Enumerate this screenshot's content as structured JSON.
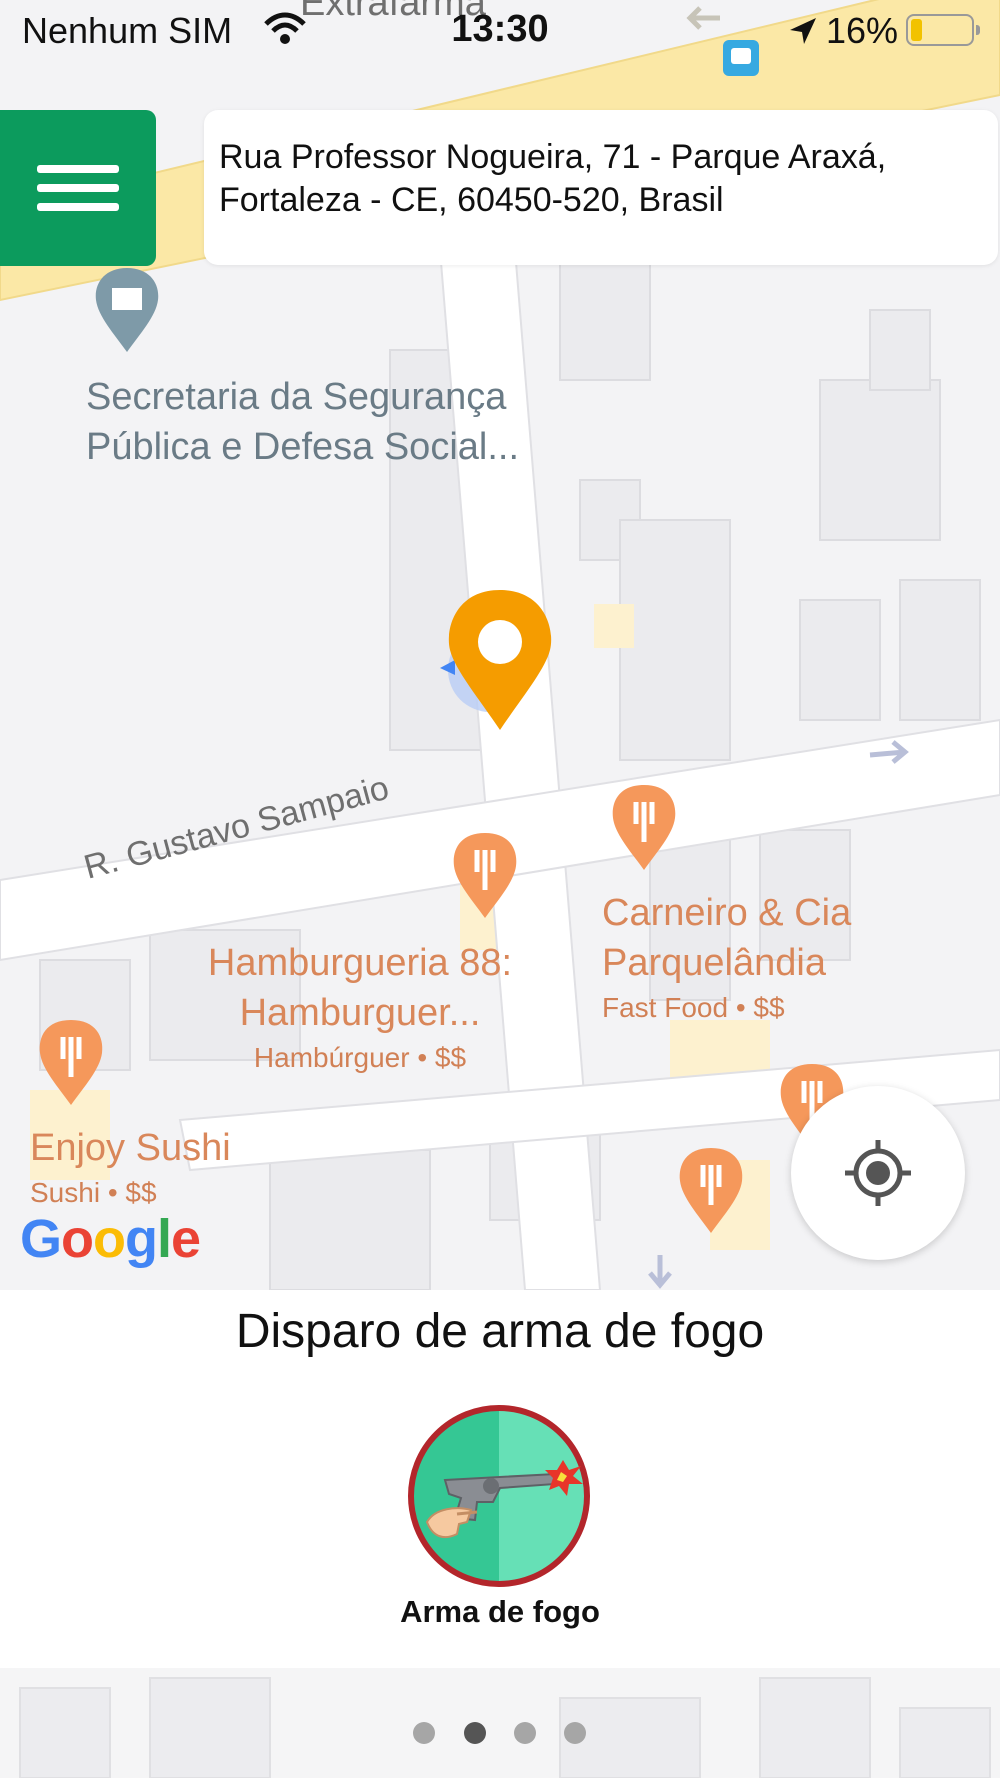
{
  "status_bar": {
    "carrier": "Nenhum SIM",
    "time": "13:30",
    "battery_percent": "16%",
    "battery_level": 0.16
  },
  "header": {
    "menu_icon": "hamburger-menu-icon",
    "address": "Rua Professor Nogueira, 71 - Parque Araxá, Fortaleza - CE, 60450-520, Brasil"
  },
  "map": {
    "top_label": "Extrafarma",
    "pois": [
      {
        "name": "Secretaria da Segurança Pública e Defesa Social...",
        "icon": "government-building-icon"
      },
      {
        "name": "Hamburgueria 88: Hamburguer...",
        "sub": "Hambúrguer • $$",
        "icon": "restaurant-icon"
      },
      {
        "name": "Carneiro & Cia Parquelândia",
        "sub": "Fast Food • $$",
        "icon": "restaurant-icon"
      },
      {
        "name": "Enjoy Sushi",
        "sub": "Sushi • $$",
        "icon": "restaurant-icon"
      }
    ],
    "street": "R. Gustavo Sampaio",
    "attribution": "Google",
    "colors": {
      "road_major": "#fbe8a6",
      "poi_orange": "#f5985b",
      "marker_orange": "#f59c00",
      "menu_green": "#0c9b5d"
    }
  },
  "panel": {
    "title": "Disparo de arma de fogo",
    "category_label": "Arma de fogo",
    "category_icon": "firearm-icon",
    "page_count": 4,
    "active_page": 2
  }
}
